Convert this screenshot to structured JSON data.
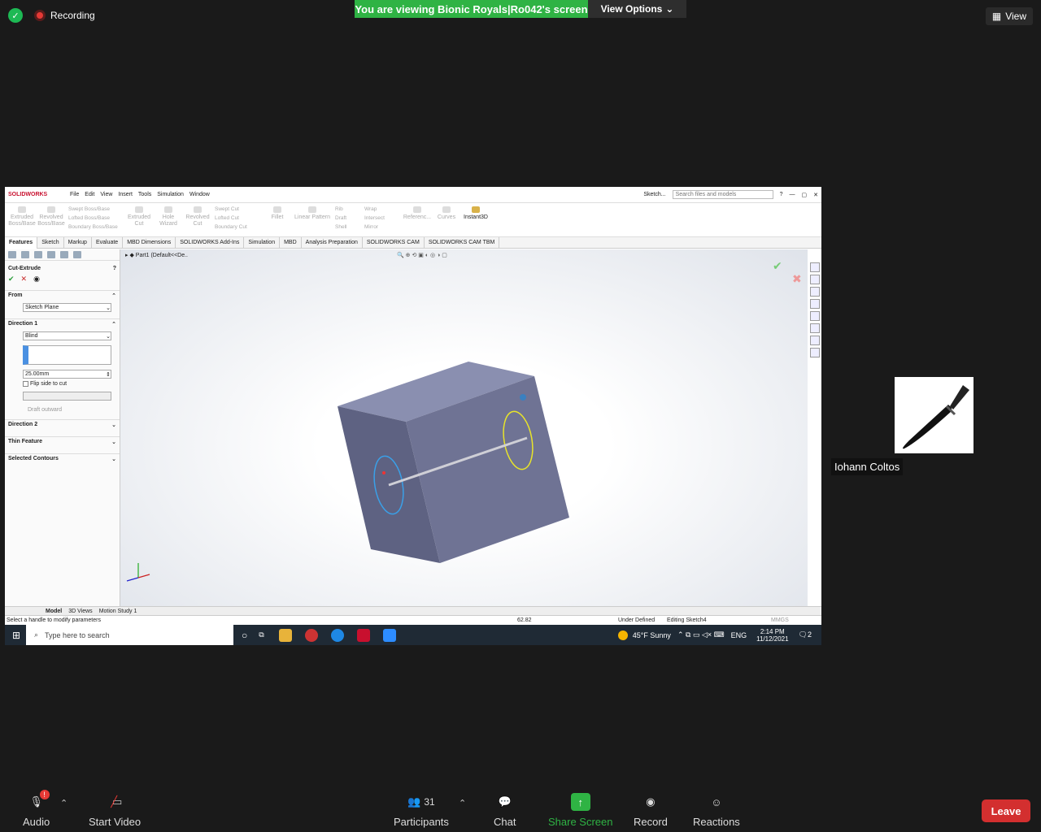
{
  "zoom": {
    "recording_label": "Recording",
    "banner_text": "You are viewing Bionic Royals|Ro042's screen",
    "view_options_label": "View Options",
    "view_label": "View",
    "participant_name": "Iohann Coltos",
    "participants_count": "31",
    "toolbar": {
      "audio": "Audio",
      "start_video": "Start Video",
      "participants": "Participants",
      "chat": "Chat",
      "share_screen": "Share Screen",
      "record": "Record",
      "reactions": "Reactions",
      "leave": "Leave"
    },
    "colors": {
      "green": "#2fb344",
      "leave": "#d32f2f",
      "rec": "#e53935"
    }
  },
  "solidworks": {
    "logo": "SOLIDWORKS",
    "menu": [
      "File",
      "Edit",
      "View",
      "Insert",
      "Tools",
      "Simulation",
      "Window"
    ],
    "sketch_label": "Sketch...",
    "search_placeholder": "Search files and models",
    "ribbon": {
      "extruded": "Extruded Boss/Base",
      "revolved": "Revolved Boss/Base",
      "swept": "Swept Boss/Base",
      "lofted": "Lofted Boss/Base",
      "boundary": "Boundary Boss/Base",
      "extruded_cut": "Extruded Cut",
      "hole_wizard": "Hole Wizard",
      "revolved_cut": "Revolved Cut",
      "swept_cut": "Swept Cut",
      "lofted_cut": "Lofted Cut",
      "boundary_cut": "Boundary Cut",
      "fillet": "Fillet",
      "linear_pattern": "Linear Pattern",
      "rib": "Rib",
      "draft": "Draft",
      "shell": "Shell",
      "wrap": "Wrap",
      "intersect": "Intersect",
      "mirror": "Mirror",
      "reference": "Referenc...",
      "curves": "Curves",
      "instant3d": "Instant3D"
    },
    "tabs": [
      "Features",
      "Sketch",
      "Markup",
      "Evaluate",
      "MBD Dimensions",
      "SOLIDWORKS Add-Ins",
      "Simulation",
      "MBD",
      "Analysis Preparation",
      "SOLIDWORKS CAM",
      "SOLIDWORKS CAM TBM"
    ],
    "tree_item": "Part1  (Default<<De..",
    "panel": {
      "title": "Cut-Extrude",
      "from_label": "From",
      "from_value": "Sketch Plane",
      "direction1": "Direction 1",
      "end_condition": "Blind",
      "depth": "25.00mm",
      "flip_side": "Flip side to cut",
      "draft_outward": "Draft outward",
      "direction2": "Direction 2",
      "thin_feature": "Thin Feature",
      "selected_contours": "Selected Contours"
    },
    "bottom_tabs": [
      "Model",
      "3D Views",
      "Motion Study 1"
    ],
    "status": {
      "hint": "Select a handle to modify parameters",
      "value": "62.82",
      "defined": "Under Defined",
      "editing": "Editing Sketch4",
      "units": "MMGS"
    }
  },
  "taskbar": {
    "search_placeholder": "Type here to search",
    "weather": "45°F  Sunny",
    "lang": "ENG",
    "time": "2:14 PM",
    "date": "11/12/2021",
    "notif_count": "2"
  }
}
